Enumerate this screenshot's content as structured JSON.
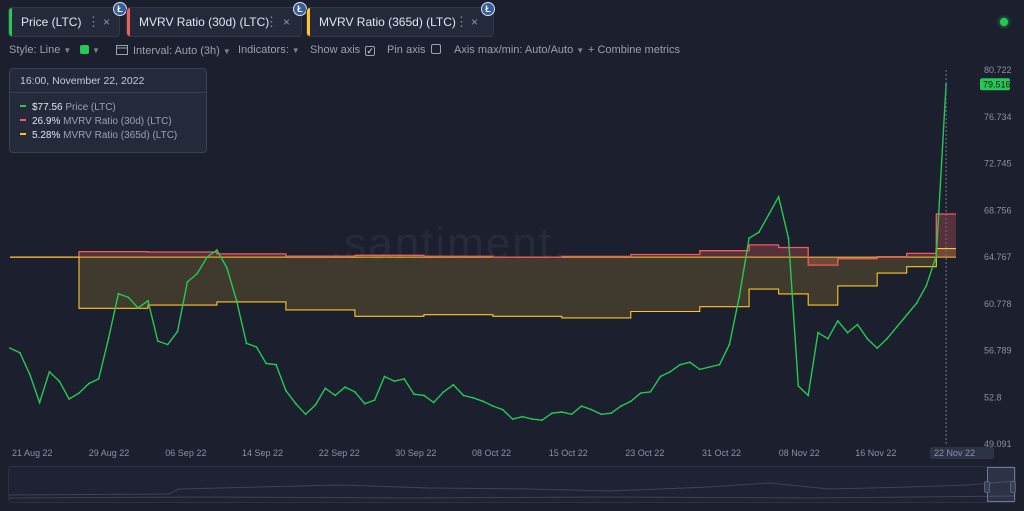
{
  "tabs": [
    {
      "label": "Price (LTC)",
      "color": "#26c953",
      "coin": "Ł"
    },
    {
      "label": "MVRV Ratio (30d) (LTC)",
      "color": "#ef5d5d",
      "coin": "Ł"
    },
    {
      "label": "MVRV Ratio (365d) (LTC)",
      "color": "#ffc52a",
      "coin": "Ł"
    }
  ],
  "tab_icons": {
    "menu": "⋮",
    "close": "×"
  },
  "toolbar": {
    "style": "Style: Line",
    "interval": "Interval: Auto (3h)",
    "indicators": "Indicators:",
    "show_axis": "Show axis",
    "show_axis_checked": "✓",
    "pin_axis": "Pin axis",
    "axis_minmax": "Axis max/min: Auto/Auto",
    "combine": "+ Combine metrics"
  },
  "tooltip": {
    "date": "16:00, November 22, 2022",
    "rows": [
      {
        "value": "$77.56",
        "label": "Price (LTC)",
        "color": "#26c953"
      },
      {
        "value": "26.9%",
        "label": "MVRV Ratio (30d) (LTC)",
        "color": "#ef5d5d"
      },
      {
        "value": "5.28%",
        "label": "MVRV Ratio (365d) (LTC)",
        "color": "#ffc52a"
      }
    ]
  },
  "watermark": ".santiment.",
  "chart_data": {
    "type": "line",
    "title": "",
    "price_axis": {
      "ticks": [
        "80.722",
        "76.734",
        "72.745",
        "68.756",
        "64.767",
        "60.778",
        "56.789",
        "52.8",
        "49.091"
      ],
      "current_label": "79.516",
      "ylim": [
        49.091,
        80.722
      ]
    },
    "x_ticks": [
      "21 Aug 22",
      "29 Aug 22",
      "06 Sep 22",
      "14 Sep 22",
      "22 Sep 22",
      "30 Sep 22",
      "08 Oct 22",
      "15 Oct 22",
      "23 Oct 22",
      "31 Oct 22",
      "08 Nov 22",
      "16 Nov 22",
      "22 Nov 22"
    ],
    "x_range": [
      "2022-08-20",
      "2022-11-24"
    ],
    "series": [
      {
        "name": "Price (LTC)",
        "color": "#26c953",
        "unit": "USD",
        "x": [
          "2022-08-20",
          "2022-08-21",
          "2022-08-22",
          "2022-08-23",
          "2022-08-24",
          "2022-08-25",
          "2022-08-26",
          "2022-08-27",
          "2022-08-28",
          "2022-08-29",
          "2022-08-30",
          "2022-08-31",
          "2022-09-01",
          "2022-09-02",
          "2022-09-03",
          "2022-09-04",
          "2022-09-05",
          "2022-09-06",
          "2022-09-07",
          "2022-09-08",
          "2022-09-09",
          "2022-09-10",
          "2022-09-11",
          "2022-09-12",
          "2022-09-13",
          "2022-09-14",
          "2022-09-15",
          "2022-09-16",
          "2022-09-17",
          "2022-09-18",
          "2022-09-19",
          "2022-09-20",
          "2022-09-21",
          "2022-09-22",
          "2022-09-23",
          "2022-09-24",
          "2022-09-25",
          "2022-09-26",
          "2022-09-27",
          "2022-09-28",
          "2022-09-29",
          "2022-09-30",
          "2022-10-01",
          "2022-10-02",
          "2022-10-03",
          "2022-10-04",
          "2022-10-05",
          "2022-10-06",
          "2022-10-07",
          "2022-10-08",
          "2022-10-09",
          "2022-10-10",
          "2022-10-11",
          "2022-10-12",
          "2022-10-13",
          "2022-10-14",
          "2022-10-15",
          "2022-10-16",
          "2022-10-17",
          "2022-10-18",
          "2022-10-19",
          "2022-10-20",
          "2022-10-21",
          "2022-10-22",
          "2022-10-23",
          "2022-10-24",
          "2022-10-25",
          "2022-10-26",
          "2022-10-27",
          "2022-10-28",
          "2022-10-29",
          "2022-10-30",
          "2022-10-31",
          "2022-11-01",
          "2022-11-02",
          "2022-11-03",
          "2022-11-04",
          "2022-11-05",
          "2022-11-06",
          "2022-11-07",
          "2022-11-08",
          "2022-11-09",
          "2022-11-10",
          "2022-11-11",
          "2022-11-12",
          "2022-11-13",
          "2022-11-14",
          "2022-11-15",
          "2022-11-16",
          "2022-11-17",
          "2022-11-18",
          "2022-11-19",
          "2022-11-20",
          "2022-11-21",
          "2022-11-22",
          "2022-11-23"
        ],
        "values": [
          57.2,
          56.8,
          55.0,
          52.6,
          55.2,
          54.4,
          52.9,
          53.4,
          54.2,
          54.6,
          58.0,
          61.8,
          61.5,
          60.6,
          61.2,
          57.8,
          57.5,
          58.6,
          62.8,
          63.5,
          64.9,
          65.5,
          64.0,
          61.2,
          57.6,
          57.3,
          55.9,
          55.8,
          53.6,
          52.5,
          51.6,
          52.4,
          53.8,
          53.2,
          53.9,
          53.5,
          52.5,
          52.8,
          54.8,
          54.4,
          54.6,
          53.3,
          53.2,
          52.6,
          53.5,
          54.1,
          53.2,
          53.0,
          52.7,
          52.3,
          52.0,
          51.2,
          51.4,
          51.2,
          51.1,
          51.7,
          51.8,
          51.6,
          52.3,
          52.0,
          51.6,
          51.7,
          52.3,
          52.7,
          53.4,
          53.5,
          54.8,
          55.2,
          55.8,
          56.0,
          55.4,
          55.6,
          55.8,
          57.5,
          61.5,
          66.5,
          67.0,
          68.5,
          70.0,
          66.5,
          54.0,
          53.2,
          58.5,
          58.0,
          59.5,
          58.5,
          59.2,
          58.0,
          57.2,
          58.0,
          59.0,
          60.0,
          61.0,
          62.5,
          65.0,
          79.5
        ]
      },
      {
        "name": "MVRV Ratio (30d) (LTC)",
        "color": "#ef5d5d",
        "unit": "%",
        "x": [
          "2022-08-20",
          "2022-08-27",
          "2022-09-03",
          "2022-09-10",
          "2022-09-17",
          "2022-09-24",
          "2022-10-01",
          "2022-10-08",
          "2022-10-15",
          "2022-10-22",
          "2022-10-29",
          "2022-11-03",
          "2022-11-06",
          "2022-11-09",
          "2022-11-12",
          "2022-11-16",
          "2022-11-19",
          "2022-11-22"
        ],
        "values": [
          0,
          3.4,
          3.2,
          2.0,
          0.6,
          1.1,
          0.5,
          0.0,
          0.4,
          1.6,
          4.0,
          7.6,
          6.0,
          -5.0,
          -1.0,
          0.3,
          2.3,
          26.9
        ]
      },
      {
        "name": "MVRV Ratio (365d) (LTC)",
        "color": "#ffc52a",
        "unit": "%",
        "x": [
          "2022-08-20",
          "2022-08-27",
          "2022-09-03",
          "2022-09-10",
          "2022-09-17",
          "2022-09-24",
          "2022-10-01",
          "2022-10-08",
          "2022-10-15",
          "2022-10-22",
          "2022-10-29",
          "2022-11-03",
          "2022-11-06",
          "2022-11-09",
          "2022-11-12",
          "2022-11-16",
          "2022-11-19",
          "2022-11-22"
        ],
        "values": [
          0,
          -32,
          -30,
          -28,
          -33,
          -37,
          -36,
          -37,
          -38,
          -34,
          -31,
          -20,
          -23,
          -30,
          -18,
          -10,
          -6,
          5.28
        ]
      }
    ],
    "baseline_color": "#ffc52a",
    "grid": false,
    "legend": "top-left tooltip"
  }
}
